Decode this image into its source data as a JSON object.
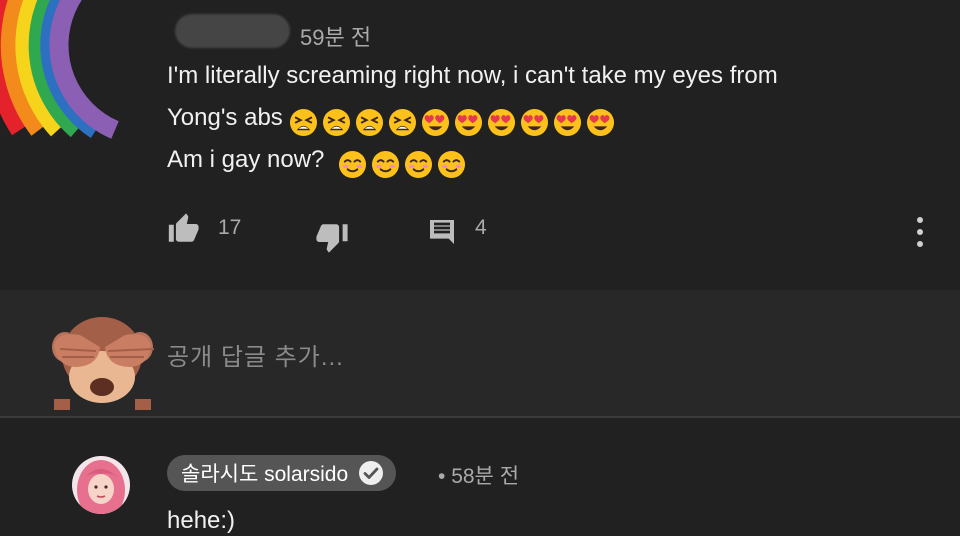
{
  "comment": {
    "time": "59분 전",
    "line1": "I'm literally screaming right now, i can't take my eyes from",
    "line2": "Yong's abs",
    "line3": "Am i gay now?",
    "emoji_line2": [
      "tired-face-emoji",
      "tired-face-emoji",
      "tired-face-emoji",
      "tired-face-emoji",
      "heart-eyes-emoji",
      "heart-eyes-emoji",
      "heart-eyes-emoji",
      "heart-eyes-emoji",
      "heart-eyes-emoji",
      "heart-eyes-emoji"
    ],
    "emoji_line3": [
      "smiling-face-emoji",
      "smiling-face-emoji",
      "smiling-face-emoji",
      "smiling-face-emoji"
    ],
    "like_count": "17",
    "reply_count": "4"
  },
  "reply_input": {
    "placeholder": "공개 답글 추가..."
  },
  "reply": {
    "channel_name": "솔라시도 solarsido",
    "separator": "•",
    "time": "58분 전",
    "text": "hehe:)"
  },
  "colors": {
    "background": "#212121",
    "reply_section": "#282828",
    "secondary_text": "#aaaaaa",
    "chip": "#555555"
  },
  "icons": {
    "avatar_top": "rainbow-icon",
    "like": "thumbs-up-icon",
    "dislike": "thumbs-down-icon",
    "reply": "comment-icon",
    "more": "more-vert-icon",
    "verified": "verified-check-icon",
    "input_avatar": "see-no-evil-monkey-icon"
  }
}
